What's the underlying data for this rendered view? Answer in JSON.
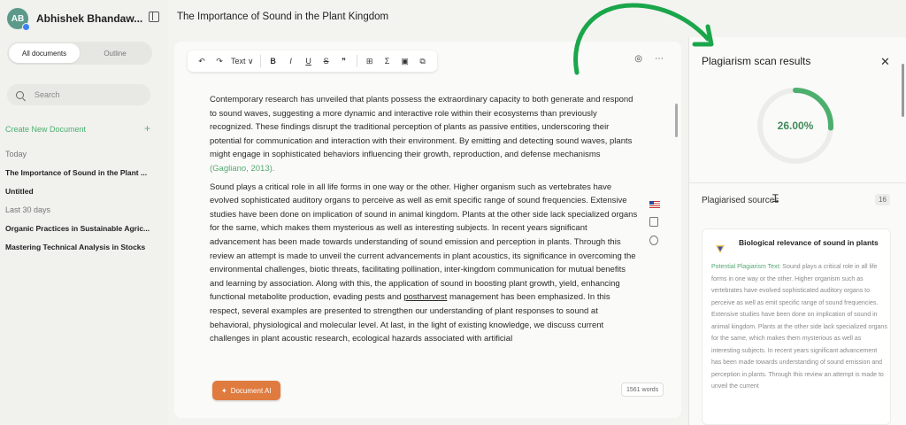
{
  "sidebar": {
    "user_initials": "AB",
    "user_name": "Abhishek Bhandaw...",
    "tabs": [
      "All documents",
      "Outline"
    ],
    "search_placeholder": "Search",
    "create_label": "Create New Document",
    "create_icon": "+",
    "sections": [
      {
        "label": "Today",
        "items": [
          "The Importance of Sound in the Plant ...",
          "Untitled"
        ]
      },
      {
        "label": "Last 30 days",
        "items": [
          "Organic Practices in Sustainable Agric...",
          "Mastering Technical Analysis in Stocks"
        ]
      }
    ]
  },
  "header": {
    "doc_title": "The Importance of Sound in the Plant Kingdom"
  },
  "toolbar": {
    "undo": "↶",
    "redo": "↷",
    "style_select": "Text ∨",
    "bold": "B",
    "italic": "I",
    "underline": "U",
    "strike": "S",
    "quote": "❞",
    "table": "⊞",
    "sigma": "Σ",
    "image": "▣",
    "copy": "⧉",
    "settings": "◎",
    "more": "⋯"
  },
  "document": {
    "p1": "Contemporary research has unveiled that plants possess the extraordinary capacity to both generate and respond to sound waves, suggesting a more dynamic and interactive role within their ecosystems than previously recognized. These findings disrupt the traditional perception of plants as passive entities, underscoring their potential for communication and interaction with their environment. By emitting and detecting sound waves, plants might engage in sophisticated behaviors influencing their growth, reproduction, and defense mechanisms",
    "p1_cite": "(Gagliano, 2013).",
    "p2_before": "Sound plays a critical role in all life forms in one way or the other. Higher organism such as vertebrates have evolved sophisticated auditory organs to perceive as well as emit specific range of sound frequencies. Extensive studies have been done on implication of sound in animal kingdom. Plants at the other side lack specialized organs for the same, which makes them mysterious as well as interesting subjects. In recent years significant advancement has been made towards understanding of sound emission and perception in plants. Through this review an attempt is made to unveil the current advancements in plant acoustics, its significance in overcoming the environmental challenges, biotic threats, facilitating pollination, inter-kingdom communication for mutual benefits and learning by association. Along with this, the application of sound in boosting plant growth, yield, enhancing functional metabolite production, evading pests and",
    "p2_underlined": "postharvest",
    "p2_after": "management has been emphasized. In this respect, several examples are presented to strengthen our understanding of plant responses to sound at behavioral, physiological and molecular level. At last, in the light of existing knowledge, we discuss current challenges in plant acoustic research, ecological hazards associated with artificial",
    "doc_ai_label": "Document AI",
    "word_count": "1561 words"
  },
  "results": {
    "title": "Plagiarism scan results",
    "close": "✕",
    "score_text": "26.00%",
    "score_fraction": 0.26,
    "sources_title": "Plagiarised sources",
    "sources_count": "16",
    "source": {
      "title": "Biological relevance of sound in plants",
      "label": "Potential Plagiarism Text:",
      "text": "Sound plays a critical role in all life forms in one way or the other. Higher organism such as vertebrates have evolved sophisticated auditory organs to perceive as well as emit specific range of sound frequencies. Extensive studies have been done on implication of sound in animal kingdom. Plants at the other side lack specialized organs for the same, which makes them mysterious as well as interesting subjects. In recent years significant advancement has been made towards understanding of sound emission and perception in plants. Through this review an attempt is made to unveil the current"
    }
  },
  "colors": {
    "accent_green": "#4caf6e",
    "doc_ai_orange": "#e07b3f",
    "arrow_green": "#1aa64a"
  }
}
